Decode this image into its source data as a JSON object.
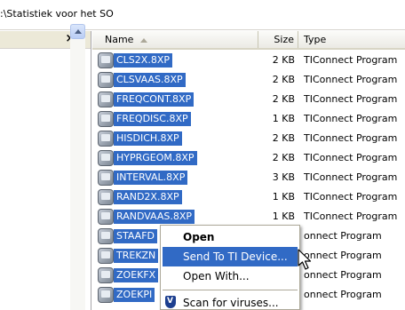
{
  "address": {
    "path": ":\\Statistiek voor het SO"
  },
  "leftpane": {
    "close_glyph": "×"
  },
  "columns": {
    "name": "Name",
    "size": "Size",
    "type": "Type"
  },
  "files": [
    {
      "name": "CLS2X.8XP",
      "size": "2 KB",
      "type": "TIConnect Program"
    },
    {
      "name": "CLSVAAS.8XP",
      "size": "2 KB",
      "type": "TIConnect Program"
    },
    {
      "name": "FREQCONT.8XP",
      "size": "2 KB",
      "type": "TIConnect Program"
    },
    {
      "name": "FREQDISC.8XP",
      "size": "1 KB",
      "type": "TIConnect Program"
    },
    {
      "name": "HISDICH.8XP",
      "size": "2 KB",
      "type": "TIConnect Program"
    },
    {
      "name": "HYPRGEOM.8XP",
      "size": "2 KB",
      "type": "TIConnect Program"
    },
    {
      "name": "INTERVAL.8XP",
      "size": "3 KB",
      "type": "TIConnect Program"
    },
    {
      "name": "RAND2X.8XP",
      "size": "1 KB",
      "type": "TIConnect Program"
    },
    {
      "name": "RANDVAAS.8XP",
      "size": "1 KB",
      "type": "TIConnect Program"
    },
    {
      "name": "STAAFD",
      "size": "",
      "type": "onnect Program"
    },
    {
      "name": "TREKZN",
      "size": "",
      "type": "onnect Program"
    },
    {
      "name": "ZOEKFX",
      "size": "",
      "type": "onnect Program"
    },
    {
      "name": "ZOEKPI",
      "size": "",
      "type": "onnect Program"
    }
  ],
  "context_menu": {
    "open": "Open",
    "send_to_ti": "Send To TI Device...",
    "open_with": "Open With...",
    "scan": "Scan for viruses..."
  },
  "colors": {
    "selection": "#316ac5",
    "menu_highlight": "#316ac5"
  }
}
